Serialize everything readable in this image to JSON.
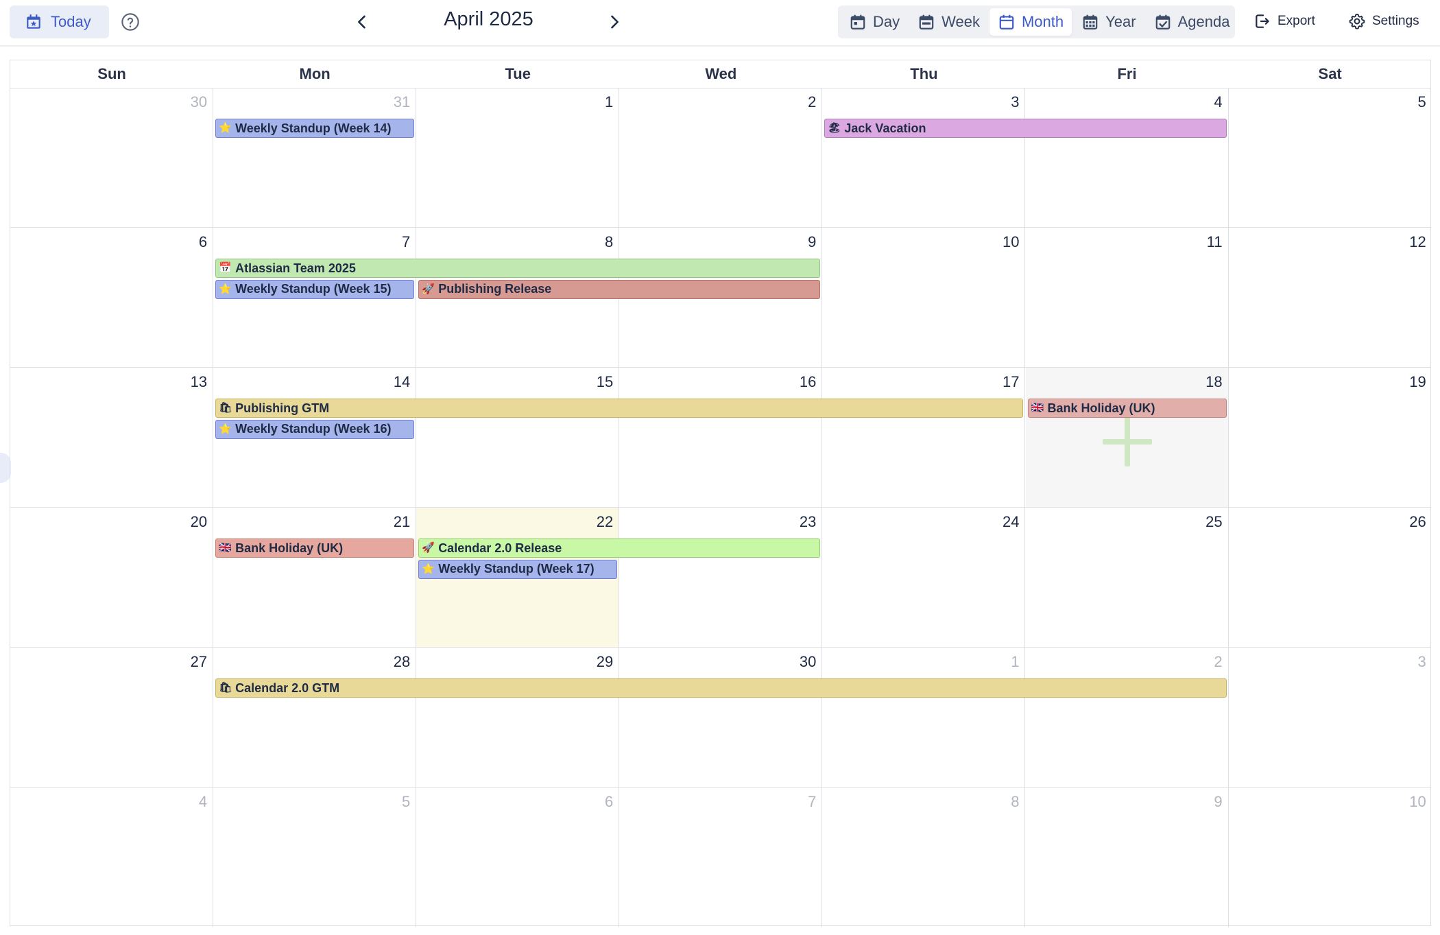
{
  "toolbar": {
    "today_label": "Today",
    "month_title": "April 2025",
    "views": [
      {
        "label": "Day",
        "icon": "calendar-day-icon"
      },
      {
        "label": "Week",
        "icon": "calendar-week-icon"
      },
      {
        "label": "Month",
        "icon": "calendar-month-icon",
        "active": true
      },
      {
        "label": "Year",
        "icon": "calendar-year-icon"
      },
      {
        "label": "Agenda",
        "icon": "calendar-check-icon"
      }
    ],
    "export_label": "Export",
    "settings_label": "Settings"
  },
  "weekdays": [
    "Sun",
    "Mon",
    "Tue",
    "Wed",
    "Thu",
    "Fri",
    "Sat"
  ],
  "weeks": [
    {
      "days": [
        {
          "n": "30",
          "muted": true
        },
        {
          "n": "31",
          "muted": true
        },
        {
          "n": "1"
        },
        {
          "n": "2"
        },
        {
          "n": "3"
        },
        {
          "n": "4"
        },
        {
          "n": "5"
        }
      ]
    },
    {
      "days": [
        {
          "n": "6"
        },
        {
          "n": "7"
        },
        {
          "n": "8"
        },
        {
          "n": "9"
        },
        {
          "n": "10"
        },
        {
          "n": "11"
        },
        {
          "n": "12"
        }
      ]
    },
    {
      "days": [
        {
          "n": "13"
        },
        {
          "n": "14"
        },
        {
          "n": "15"
        },
        {
          "n": "16"
        },
        {
          "n": "17"
        },
        {
          "n": "18",
          "hover": true
        },
        {
          "n": "19"
        }
      ]
    },
    {
      "days": [
        {
          "n": "20"
        },
        {
          "n": "21"
        },
        {
          "n": "22",
          "today": true
        },
        {
          "n": "23"
        },
        {
          "n": "24"
        },
        {
          "n": "25"
        },
        {
          "n": "26"
        }
      ]
    },
    {
      "days": [
        {
          "n": "27"
        },
        {
          "n": "28"
        },
        {
          "n": "29"
        },
        {
          "n": "30"
        },
        {
          "n": "1",
          "muted": true
        },
        {
          "n": "2",
          "muted": true
        },
        {
          "n": "3",
          "muted": true
        }
      ]
    },
    {
      "days": [
        {
          "n": "4",
          "muted": true
        },
        {
          "n": "5",
          "muted": true
        },
        {
          "n": "6",
          "muted": true
        },
        {
          "n": "7",
          "muted": true
        },
        {
          "n": "8",
          "muted": true
        },
        {
          "n": "9",
          "muted": true
        },
        {
          "n": "10",
          "muted": true
        }
      ]
    }
  ],
  "events": [
    {
      "week": 0,
      "start": 1,
      "span": 1,
      "lane": 0,
      "title": "Weekly Standup (Week 14)",
      "emoji": "⭐",
      "color": "blue"
    },
    {
      "week": 0,
      "start": 4,
      "span": 2,
      "lane": 0,
      "title": "Jack Vacation",
      "emoji": "🏖",
      "color": "purple"
    },
    {
      "week": 1,
      "start": 1,
      "span": 3,
      "lane": 0,
      "title": "Atlassian Team 2025",
      "emoji": "📅",
      "color": "green"
    },
    {
      "week": 1,
      "start": 1,
      "span": 1,
      "lane": 1,
      "title": "Weekly Standup (Week 15)",
      "emoji": "⭐",
      "color": "blue"
    },
    {
      "week": 1,
      "start": 2,
      "span": 2,
      "lane": 1,
      "title": "Publishing Release",
      "emoji": "🚀",
      "color": "red"
    },
    {
      "week": 2,
      "start": 1,
      "span": 4,
      "lane": 0,
      "title": "Publishing GTM",
      "emoji": "🛍",
      "color": "yellow"
    },
    {
      "week": 2,
      "start": 5,
      "span": 1,
      "lane": 0,
      "title": "Bank Holiday (UK)",
      "emoji": "🇬🇧",
      "color": "pink"
    },
    {
      "week": 2,
      "start": 1,
      "span": 1,
      "lane": 1,
      "title": "Weekly Standup (Week 16)",
      "emoji": "⭐",
      "color": "blue"
    },
    {
      "week": 3,
      "start": 1,
      "span": 1,
      "lane": 0,
      "title": "Bank Holiday (UK)",
      "emoji": "🇬🇧",
      "color": "salmon"
    },
    {
      "week": 3,
      "start": 2,
      "span": 2,
      "lane": 0,
      "title": "Calendar 2.0 Release",
      "emoji": "🚀",
      "color": "lime"
    },
    {
      "week": 3,
      "start": 2,
      "span": 1,
      "lane": 1,
      "title": "Weekly Standup (Week 17)",
      "emoji": "⭐",
      "color": "blue"
    },
    {
      "week": 4,
      "start": 1,
      "span": 5,
      "lane": 0,
      "title": "Calendar 2.0 GTM",
      "emoji": "🛍",
      "color": "yellow"
    }
  ]
}
